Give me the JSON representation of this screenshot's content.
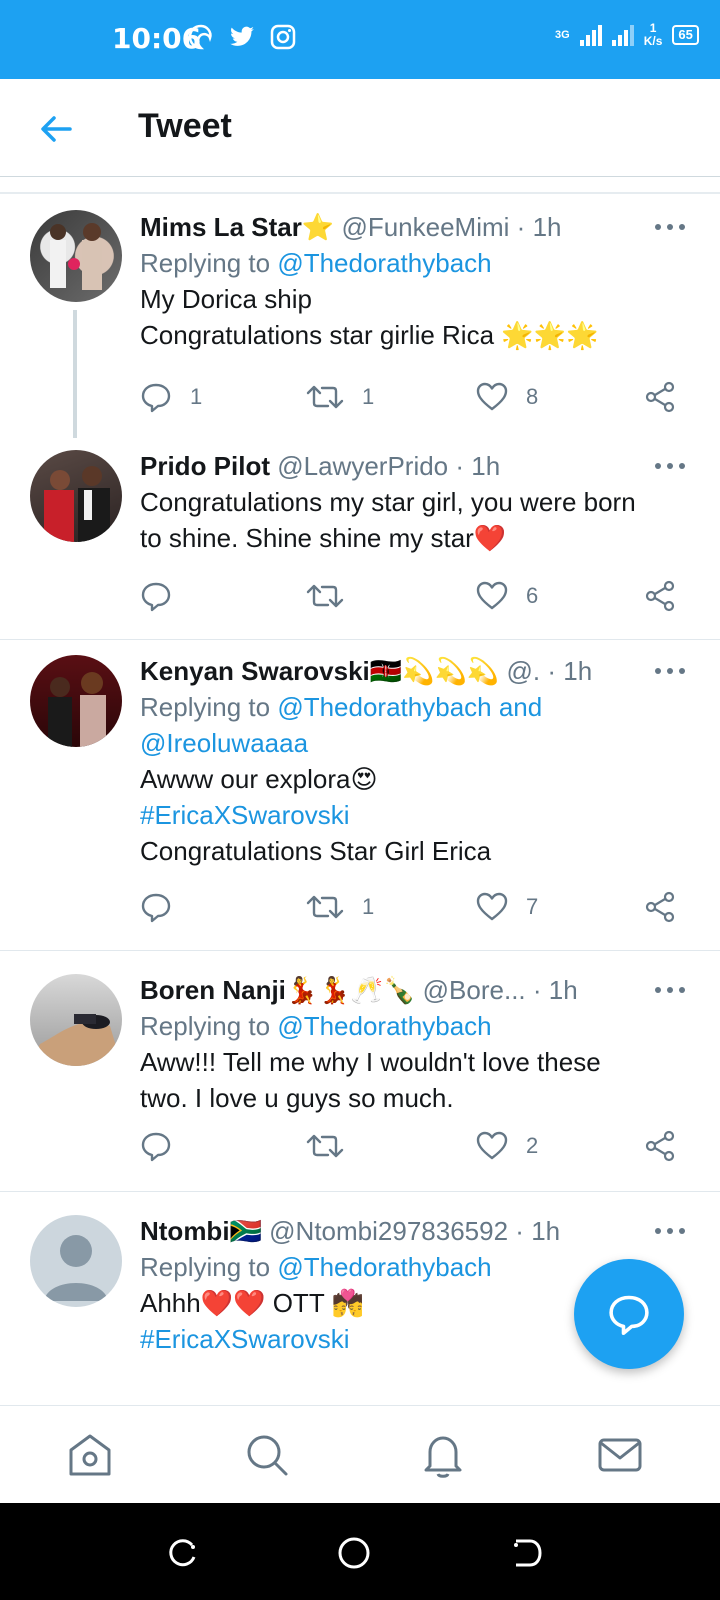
{
  "status_bar": {
    "time": "10:06",
    "network": "3G",
    "speed_value": "1",
    "speed_unit": "K/s",
    "battery": "65"
  },
  "header": {
    "title": "Tweet"
  },
  "tweets": [
    {
      "name": "Mims La Star",
      "name_emoji": "⭐",
      "handle": "@FunkeeMimi",
      "time": "1h",
      "replying_label": "Replying to",
      "replying_to": "@Thedorathybach",
      "lines": [
        "My Dorica ship",
        "Congratulations star girlie Rica"
      ],
      "line2_emoji": "🌟🌟🌟",
      "replies": "1",
      "retweets": "1",
      "likes": "8"
    },
    {
      "name": "Prido Pilot",
      "handle": "@LawyerPrido",
      "time": "1h",
      "lines": [
        "Congratulations my star girl, you were born",
        "to shine. Shine shine my star"
      ],
      "line2_emoji": "❤️",
      "replies": "",
      "retweets": "",
      "likes": "6"
    },
    {
      "name": "Kenyan Swarovski",
      "name_emoji": "🇰🇪💫💫💫",
      "handle": "@.",
      "time": "1h",
      "replying_label": "Replying to",
      "replying_to": "@Thedorathybach and",
      "replying_to_2": "@Ireoluwaaaa",
      "line1": "Awww our explora",
      "line1_emoji": "😍",
      "hashtag": "#EricaXSwarovski",
      "line3": "Congratulations Star Girl Erica",
      "replies": "",
      "retweets": "1",
      "likes": "7"
    },
    {
      "name": "Boren Nanji",
      "name_emoji": "💃💃🥂🍾",
      "handle": "@Bore...",
      "time": "1h",
      "replying_label": "Replying to",
      "replying_to": "@Thedorathybach",
      "lines": [
        "Aww!!! Tell me why I wouldn't love these",
        "two. I love u guys so much."
      ],
      "replies": "",
      "retweets": "",
      "likes": "2"
    },
    {
      "name": "Ntombi",
      "name_emoji": "🇿🇦",
      "handle": "@Ntombi297836592",
      "time": "1h",
      "replying_label": "Replying to",
      "replying_to": "@Thedorathybach",
      "line1": "Ahhh",
      "line1_emoji": "❤️❤️",
      "line1_after": " OTT ",
      "line1_emoji2": "💏",
      "hashtag": "#EricaXSwarovski"
    }
  ],
  "colors": {
    "accent": "#1da1f2",
    "mention": "#1b95e0",
    "secondary_text": "#657786",
    "primary_text": "#14171a"
  }
}
